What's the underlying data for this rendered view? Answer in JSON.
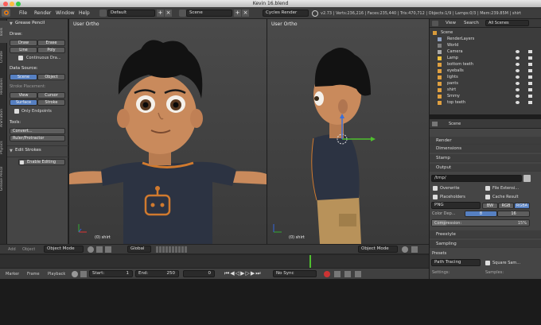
{
  "window": {
    "title": "Kevin 16.blend"
  },
  "menubar": {
    "menus": [
      "File",
      "Render",
      "Window",
      "Help"
    ],
    "layout": "Default",
    "scene": "Scene",
    "engine": "Cycles Render",
    "stats": "v2.73 | Verts:236,216 | Faces:235,440 | Tris:470,712 | Objects:1/9 | Lamps:0/3 | Mem:239.85M | shirt"
  },
  "tool_tabs": [
    "Tools",
    "Create",
    "Relations",
    "Animation",
    "Physics",
    "Grease Pencil"
  ],
  "tools": {
    "grease_header": "Grease Pencil",
    "draw_label": "Draw:",
    "draw_buttons": [
      "Draw",
      "Erase",
      "Line",
      "Poly"
    ],
    "continuous": "Continuous Dra...",
    "data_source_label": "Data Source:",
    "data_source_buttons": [
      "Scene",
      "Object"
    ],
    "stroke_placement_label": "Stroke Placement:",
    "placement_buttons": [
      "View",
      "Cursor",
      "Surface",
      "Stroke"
    ],
    "only_endpoints": "Only Endpoints",
    "tools_label": "Tools:",
    "tool_buttons": [
      "Convert...",
      "Ruler/Protractor"
    ],
    "edit_strokes_header": "Edit Strokes",
    "enable_editing": "Enable Editing"
  },
  "viewport_left": {
    "label": "User Ortho",
    "object_label": "(0) shirt"
  },
  "viewport_right": {
    "label": "User Ortho",
    "object_label": "(0) shirt"
  },
  "outliner": {
    "tabs": [
      "View",
      "Search",
      "All Scenes"
    ],
    "rows": [
      "Scene",
      "RenderLayers",
      "World",
      "Camera",
      "Lamp",
      "bottom teeth",
      "eyeballs",
      "lights",
      "pants",
      "shirt",
      "Smmy",
      "top teeth"
    ]
  },
  "properties": {
    "context": "Scene",
    "panels": [
      "Render",
      "Dimensions",
      "Stamp",
      "Output"
    ],
    "output_path": "/tmp/",
    "overwrite": "Overwrite",
    "file_extensions": "File Extensi...",
    "placeholders": "Placeholders",
    "cache_result": "Cache Result",
    "format": "PNG",
    "color_modes": [
      "BW",
      "RGB",
      "RGBA"
    ],
    "color_depth_label": "Color Dep...",
    "color_depth_options": [
      "8",
      "16"
    ],
    "compression_label": "Compression:",
    "compression_value": "15%",
    "panels_after": [
      "Freestyle",
      "Sampling"
    ],
    "presets_label": "Presets",
    "integrator": "Path Tracing",
    "square_samples": "Square Sam...",
    "settings_label": "Settings:",
    "samples_label": "Samples:"
  },
  "viewport_bar": {
    "left_buttons": [
      "Add",
      "Object"
    ],
    "mode_left": "Object Mode",
    "pivot": "Global",
    "mode_right": "Object Mode"
  },
  "timeline": {
    "menus": [
      "Marker",
      "Frame",
      "Playback"
    ],
    "start_label": "Start:",
    "start_value": "1",
    "end_label": "End:",
    "end_value": "250",
    "current_frame": "0",
    "sync": "No Sync"
  },
  "colors": {
    "accent": "#5680c2",
    "orange": "#d07a2e",
    "green": "#6fbf3b"
  }
}
